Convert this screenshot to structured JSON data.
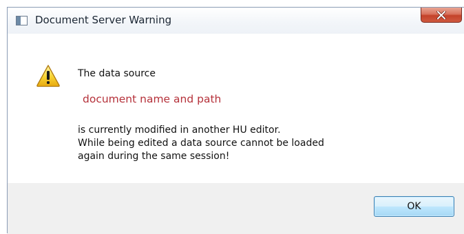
{
  "dialog": {
    "title": "Document Server Warning",
    "close_icon": "close-icon",
    "window_icon": "app-window-icon"
  },
  "message": {
    "icon": "warning-icon",
    "line1": "The data source",
    "source_name": "document name and path",
    "body_lines": [
      "is currently modified in another HU editor.",
      "While being edited a data source cannot be loaded",
      "again during the same session!"
    ]
  },
  "buttons": {
    "ok_label": "OK"
  },
  "colors": {
    "source_name": "#b5313a",
    "close_button": "#c4422b",
    "footer": "#f0f0f0",
    "ok_border": "#3c7fb1"
  }
}
